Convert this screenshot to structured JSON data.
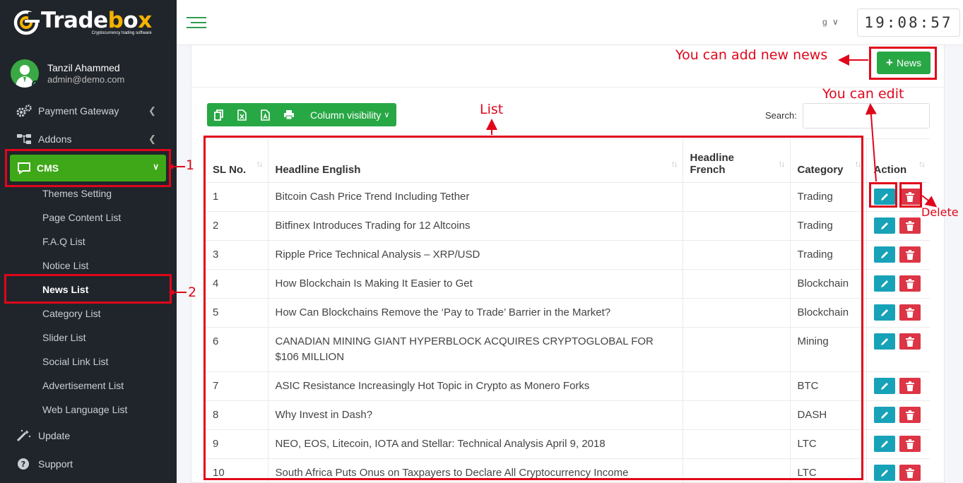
{
  "brand": {
    "name_white": "Trade",
    "name_yellow": "b",
    "name_white2": "o",
    "name_yellow2": "x",
    "tagline": "Cryptocurrency trading software"
  },
  "user": {
    "name": "Tanzil Ahammed",
    "email": "admin@demo.com"
  },
  "sidebar": {
    "items": [
      {
        "label": "Payment Gateway",
        "icon": "gears-icon"
      },
      {
        "label": "Addons",
        "icon": "sitemap-icon"
      }
    ],
    "cms": {
      "label": "CMS",
      "icon": "comment-icon"
    },
    "submenu": [
      {
        "label": "Themes Setting"
      },
      {
        "label": "Page Content List"
      },
      {
        "label": "F.A.Q List"
      },
      {
        "label": "Notice List"
      },
      {
        "label": "News List"
      },
      {
        "label": "Category List"
      },
      {
        "label": "Slider List"
      },
      {
        "label": "Social Link List"
      },
      {
        "label": "Advertisement List"
      },
      {
        "label": "Web Language List"
      }
    ],
    "bottom": [
      {
        "label": "Update",
        "icon": "magic-wand-icon"
      },
      {
        "label": "Support",
        "icon": "question-circle-icon"
      }
    ]
  },
  "header": {
    "lang": "g",
    "clock": "19:08:57"
  },
  "content": {
    "add_button": "News",
    "toolbar": {
      "column_visibility": "Column visibility"
    },
    "search_label": "Search:",
    "columns": [
      "SL No.",
      "Headline English",
      "Headline French",
      "Category",
      "Action"
    ],
    "rows": [
      {
        "sl": "1",
        "en": "Bitcoin Cash Price Trend Including Tether",
        "fr": "",
        "cat": "Trading"
      },
      {
        "sl": "2",
        "en": "Bitfinex Introduces Trading for 12 Altcoins",
        "fr": "",
        "cat": "Trading"
      },
      {
        "sl": "3",
        "en": "Ripple Price Technical Analysis – XRP/USD",
        "fr": "",
        "cat": "Trading"
      },
      {
        "sl": "4",
        "en": "How Blockchain Is Making It Easier to Get",
        "fr": "",
        "cat": "Blockchain"
      },
      {
        "sl": "5",
        "en": "How Can Blockchains Remove the ‘Pay to Trade’ Barrier in the Market?",
        "fr": "",
        "cat": "Blockchain"
      },
      {
        "sl": "6",
        "en": "CANADIAN MINING GIANT HYPERBLOCK ACQUIRES CRYPTOGLOBAL FOR $106 MILLION",
        "fr": "",
        "cat": "Mining"
      },
      {
        "sl": "7",
        "en": "ASIC Resistance Increasingly Hot Topic in Crypto as Monero Forks",
        "fr": "",
        "cat": "BTC"
      },
      {
        "sl": "8",
        "en": "Why Invest in Dash?",
        "fr": "",
        "cat": "DASH"
      },
      {
        "sl": "9",
        "en": "NEO, EOS, Litecoin, IOTA and Stellar: Technical Analysis April 9, 2018",
        "fr": "",
        "cat": "LTC"
      },
      {
        "sl": "10",
        "en": "South Africa Puts Onus on Taxpayers to Declare All Cryptocurrency Income",
        "fr": "",
        "cat": "LTC"
      }
    ]
  },
  "annotations": {
    "add_news": "You can add new news",
    "edit": "You can edit",
    "list": "List",
    "delete": "Delete",
    "num1": "1",
    "num2": "2"
  },
  "colors": {
    "annotation": "#e0061b",
    "sidebar_bg": "#20252b",
    "accent_green": "#28a745",
    "edit": "#17a2b8",
    "delete": "#dc3545"
  }
}
